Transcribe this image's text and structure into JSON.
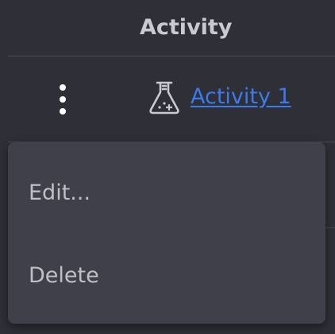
{
  "header": {
    "title": "Activity"
  },
  "row": {
    "menu_icon": "kebab-vertical-icon",
    "type_icon": "flask-icon",
    "link_label": "Activity 1"
  },
  "context_menu": {
    "items": [
      {
        "label": "Edit..."
      },
      {
        "label": "Delete"
      }
    ]
  },
  "colors": {
    "background": "#2f2f38",
    "menu_background": "#40404a",
    "link": "#3b7bea",
    "header_text": "#c9c9d2",
    "menu_text": "#bfbfc8",
    "divider": "#4b4b54"
  }
}
